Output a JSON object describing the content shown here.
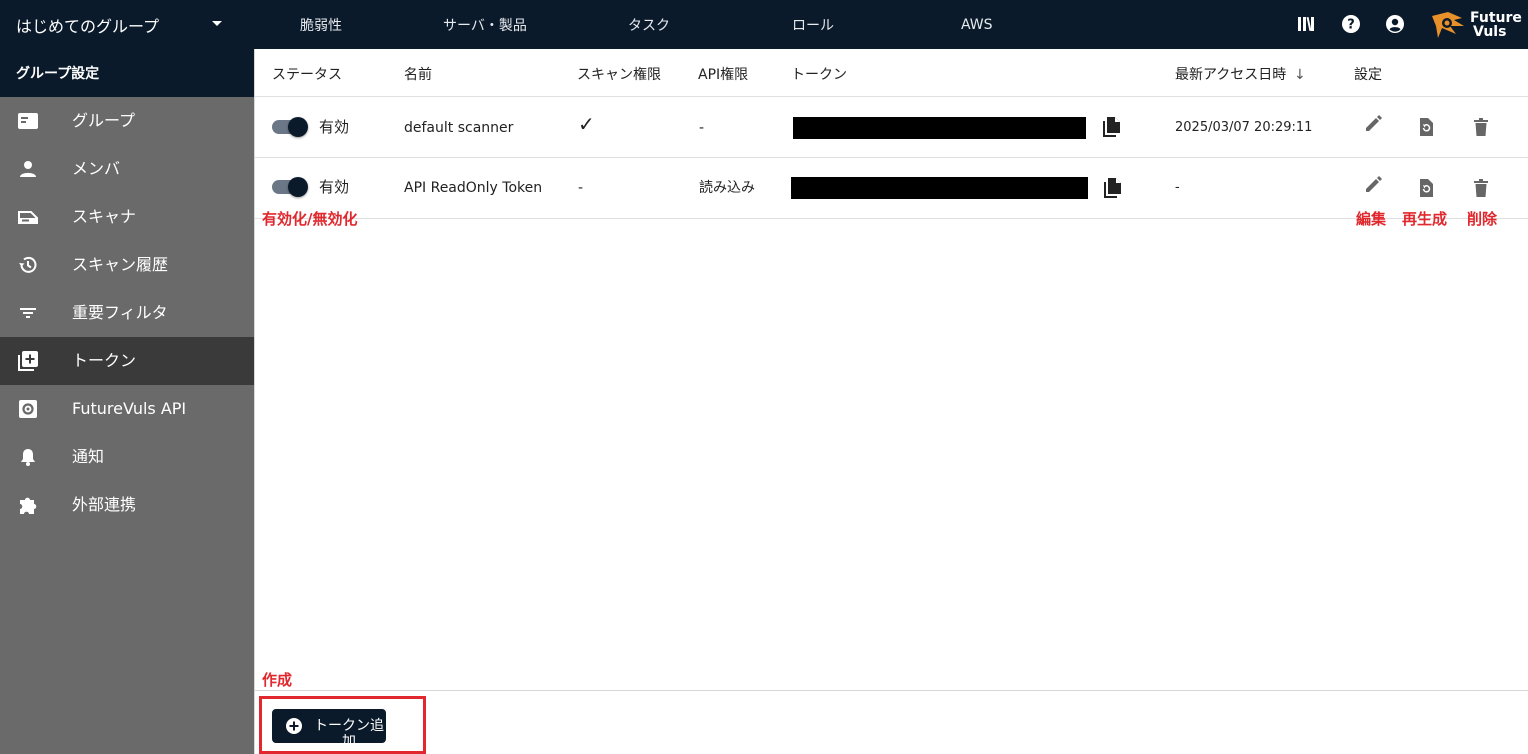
{
  "topbar": {
    "group_name": "はじめてのグループ",
    "nav": [
      "脆弱性",
      "サーバ・製品",
      "タスク",
      "ロール",
      "AWS"
    ],
    "icons": [
      "library-icon",
      "help-icon",
      "account-icon"
    ],
    "logo_text_line1": "Future",
    "logo_text_line2": "Vuls"
  },
  "sidebar": {
    "header": "グループ設定",
    "items": [
      {
        "label": "グループ",
        "icon": "group-card-icon"
      },
      {
        "label": "メンバ",
        "icon": "person-icon"
      },
      {
        "label": "スキャナ",
        "icon": "scanner-icon"
      },
      {
        "label": "スキャン履歴",
        "icon": "history-icon"
      },
      {
        "label": "重要フィルタ",
        "icon": "filter-icon"
      },
      {
        "label": "トークン",
        "icon": "add-box-icon",
        "active": true
      },
      {
        "label": "FutureVuls API",
        "icon": "api-gear-icon"
      },
      {
        "label": "通知",
        "icon": "bell-icon"
      },
      {
        "label": "外部連携",
        "icon": "puzzle-icon"
      }
    ]
  },
  "table": {
    "headers": {
      "status": "ステータス",
      "name": "名前",
      "scan_permission": "スキャン権限",
      "api_permission": "API権限",
      "token": "トークン",
      "last_access": "最新アクセス日時",
      "settings": "設定"
    },
    "sort_indicator": "↓",
    "rows": [
      {
        "status": "有効",
        "enabled": true,
        "name": "default scanner",
        "scan_permission": "✓",
        "api_permission": "-",
        "last_access": "2025/03/07 20:29:11"
      },
      {
        "status": "有効",
        "enabled": true,
        "name": "API ReadOnly Token",
        "scan_permission": "-",
        "api_permission": "読み込み",
        "last_access": "-"
      }
    ]
  },
  "annotations": {
    "toggle": "有効化/無効化",
    "edit": "編集",
    "regenerate": "再生成",
    "delete": "削除",
    "create": "作成"
  },
  "actions": {
    "add_token_label": "トークン追加"
  },
  "colors": {
    "navy": "#0b1a2a",
    "sidebar": "#6a6a6a",
    "sidebar_active": "#3a3a3a",
    "annotation_red": "#e0282e",
    "logo_orange": "#e8902a"
  }
}
